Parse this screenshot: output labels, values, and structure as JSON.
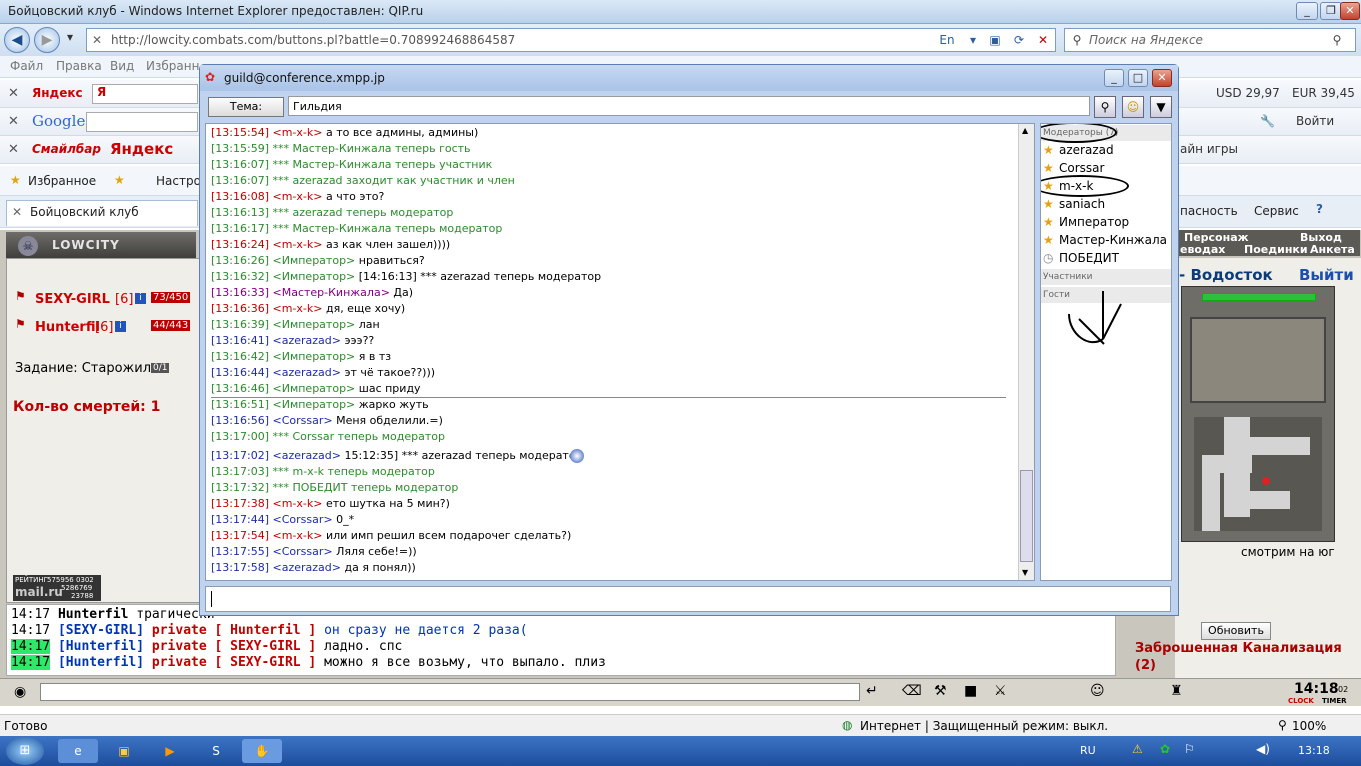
{
  "ie": {
    "title": "Бойцовский клуб - Windows Internet Explorer предоставлен: QIP.ru",
    "url": "http://lowcity.combats.com/buttons.pl?battle=0.708992468864587",
    "search_placeholder": "Поиск на Яндексе",
    "menu": [
      "Файл",
      "Правка",
      "Вид",
      "Избранн"
    ],
    "toolbar_yandex": "Яндекс",
    "toolbar_ya": "Я",
    "toolbar_google": "Google",
    "toolbar_smile": "Смайлбар",
    "toolbar_yandex2": "Яндекс",
    "usd": "USD 29,97",
    "eur": "EUR 39,45",
    "login": "Войти",
    "games": "айн игры",
    "favorites": "Избранное",
    "favorites2": "Настро",
    "tab": "Бойцовский клуб",
    "security": "пасность",
    "service": "Сервис"
  },
  "game": {
    "logo": "LOWCITY",
    "player1": "SEXY-GIRL",
    "player1_level": "[6]",
    "player1_hp": "73/450",
    "player2": "Hunterfil",
    "player2_level": "[6]",
    "player2_hp": "44/443",
    "task": "Задание: Старожил",
    "task_progress": "0/1",
    "deaths": "Кол-во смертей: 1",
    "rating_label": "РЕЙТИНГ",
    "rating_values": [
      "575956 0302",
      "5286769",
      "23788"
    ],
    "nav": [
      "Персонаж",
      "Выход"
    ],
    "nav2": [
      "еводах",
      "Поединки",
      "Анкета"
    ],
    "location": "- Водосток",
    "exit": "Выйти",
    "looking": "смотрим на юг",
    "refresh": "Обновить",
    "zone": "Заброшенная Канализация",
    "zone_count": "(2)",
    "clock": "14:18",
    "clock_sec": "02",
    "clock_lbl": "CLOCK",
    "timer_lbl": "TIMER"
  },
  "chatlog": [
    {
      "time": "14:17",
      "hl": false,
      "name": "Hunterfil",
      "priv": "",
      "text": "трагически"
    },
    {
      "time": "14:17",
      "hl": false,
      "name": "[SEXY-GIRL]",
      "priv": "private [ Hunterfil ]",
      "text": "он сразу не дается 2 раза("
    },
    {
      "time": "14:17",
      "hl": true,
      "name": "[Hunterfil]",
      "priv": "private [ SEXY-GIRL ]",
      "text": "ладно. спс"
    },
    {
      "time": "14:17",
      "hl": true,
      "name": "[Hunterfil]",
      "priv": "private [ SEXY-GIRL ]",
      "text": "можно я все возьму, что выпало. плиз"
    }
  ],
  "dialog": {
    "title": "guild@conference.xmpp.jp",
    "topic_button": "Тема:",
    "topic": "Гильдия",
    "messages": [
      {
        "ts": "[13:15:54]",
        "nick": "<m-x-k>",
        "nc": "red",
        "text": "а то все админы, админы)",
        "tc": "black"
      },
      {
        "ts": "[13:15:59]",
        "nick": "",
        "nc": "green",
        "text": "*** Мастер-Кинжала теперь гость",
        "tc": "green"
      },
      {
        "ts": "[13:16:07]",
        "nick": "",
        "nc": "green",
        "text": "*** Мастер-Кинжала теперь участник",
        "tc": "green"
      },
      {
        "ts": "[13:16:07]",
        "nick": "",
        "nc": "green",
        "text": "*** azerazad заходит как участник и член",
        "tc": "green"
      },
      {
        "ts": "[13:16:08]",
        "nick": "<m-x-k>",
        "nc": "red",
        "text": "а что это?",
        "tc": "black"
      },
      {
        "ts": "[13:16:13]",
        "nick": "",
        "nc": "green",
        "text": "*** azerazad теперь модератор",
        "tc": "green"
      },
      {
        "ts": "[13:16:17]",
        "nick": "",
        "nc": "green",
        "text": "*** Мастер-Кинжала теперь модератор",
        "tc": "green"
      },
      {
        "ts": "[13:16:24]",
        "nick": "<m-x-k>",
        "nc": "red",
        "text": "аз как член зашел))))",
        "tc": "black"
      },
      {
        "ts": "[13:16:26]",
        "nick": "<Император>",
        "nc": "green",
        "text": "нравиться?",
        "tc": "black"
      },
      {
        "ts": "[13:16:32]",
        "nick": "<Император>",
        "nc": "green",
        "text": "[14:16:13] *** azerazad теперь модератор",
        "tc": "black"
      },
      {
        "ts": "[13:16:33]",
        "nick": "<Мастер-Кинжала>",
        "nc": "purple",
        "text": "Да)",
        "tc": "black"
      },
      {
        "ts": "[13:16:36]",
        "nick": "<m-x-k>",
        "nc": "red",
        "text": "дя, еще хочу)",
        "tc": "black"
      },
      {
        "ts": "[13:16:39]",
        "nick": "<Император>",
        "nc": "green",
        "text": "лан",
        "tc": "black"
      },
      {
        "ts": "[13:16:41]",
        "nick": "<azerazad>",
        "nc": "blue",
        "text": "эээ??",
        "tc": "black"
      },
      {
        "ts": "[13:16:42]",
        "nick": "<Император>",
        "nc": "green",
        "text": "я в тз",
        "tc": "black"
      },
      {
        "ts": "[13:16:44]",
        "nick": "<azerazad>",
        "nc": "blue",
        "text": "эт чё такое??)))",
        "tc": "black"
      },
      {
        "ts": "[13:16:46]",
        "nick": "<Император>",
        "nc": "green",
        "text": "шас приду",
        "tc": "black"
      },
      {
        "ts": "[13:16:51]",
        "nick": "<Император>",
        "nc": "green",
        "text": "жарко жуть",
        "tc": "black"
      },
      {
        "ts": "[13:16:56]",
        "nick": "<Corssar>",
        "nc": "blue",
        "text": "Меня обделили.=)",
        "tc": "black"
      },
      {
        "ts": "[13:17:00]",
        "nick": "",
        "nc": "green",
        "text": "*** Corssar теперь модератор",
        "tc": "green"
      },
      {
        "ts": "[13:17:02]",
        "nick": "<azerazad>",
        "nc": "blue",
        "text": "15:12:35] *** azerazad теперь модератор",
        "tc": "black"
      },
      {
        "ts": "[13:17:03]",
        "nick": "",
        "nc": "green",
        "text": "*** m-x-k теперь модератор",
        "tc": "green"
      },
      {
        "ts": "[13:17:32]",
        "nick": "",
        "nc": "green",
        "text": "*** ПОБЕДИТ теперь модератор",
        "tc": "green"
      },
      {
        "ts": "[13:17:38]",
        "nick": "<m-x-k>",
        "nc": "red",
        "text": "ето шутка на 5 мин?)",
        "tc": "black"
      },
      {
        "ts": "[13:17:44]",
        "nick": "<Corssar>",
        "nc": "blue",
        "text": "0_*",
        "tc": "black"
      },
      {
        "ts": "[13:17:54]",
        "nick": "<m-x-k>",
        "nc": "red",
        "text": "или имп решил всем подарочег сделать?)",
        "tc": "black"
      },
      {
        "ts": "[13:17:55]",
        "nick": "<Corssar>",
        "nc": "blue",
        "text": "Ляля себе!=))",
        "tc": "black"
      },
      {
        "ts": "[13:17:58]",
        "nick": "<azerazad>",
        "nc": "blue",
        "text": "да я понял))",
        "tc": "black"
      }
    ],
    "groups": {
      "moderators": "Модераторы (7)",
      "participants": "Участники",
      "guests": "Гости"
    },
    "users": [
      "azerazad",
      "Corssar",
      "m-x-k",
      "saniach",
      "Император",
      "Мастер-Кинжала",
      "ПОБЕДИТ"
    ]
  },
  "status": {
    "ready": "Готово",
    "zone": "Интернет | Защищенный режим: выкл.",
    "zoom": "100%"
  },
  "taskbar": {
    "lang": "RU",
    "time": "13:18"
  }
}
